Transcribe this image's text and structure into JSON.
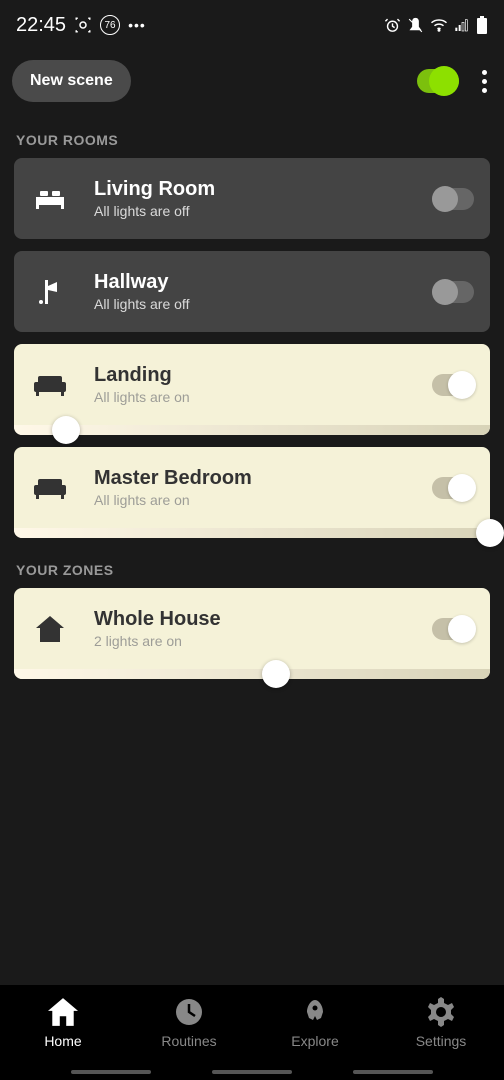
{
  "status_bar": {
    "time": "22:45",
    "badge": "76"
  },
  "header": {
    "new_scene_label": "New scene"
  },
  "sections": {
    "rooms_title": "YOUR ROOMS",
    "zones_title": "YOUR ZONES"
  },
  "rooms": [
    {
      "name": "Living Room",
      "status": "All lights are off",
      "on": false
    },
    {
      "name": "Hallway",
      "status": "All lights are off",
      "on": false
    },
    {
      "name": "Landing",
      "status": "All lights are on",
      "on": true,
      "slider_pct": 11
    },
    {
      "name": "Master Bedroom",
      "status": "All lights are on",
      "on": true,
      "slider_pct": 100
    }
  ],
  "zones": [
    {
      "name": "Whole House",
      "status": "2 lights are on",
      "on": true,
      "slider_pct": 55
    }
  ],
  "nav": {
    "home": "Home",
    "routines": "Routines",
    "explore": "Explore",
    "settings": "Settings"
  }
}
